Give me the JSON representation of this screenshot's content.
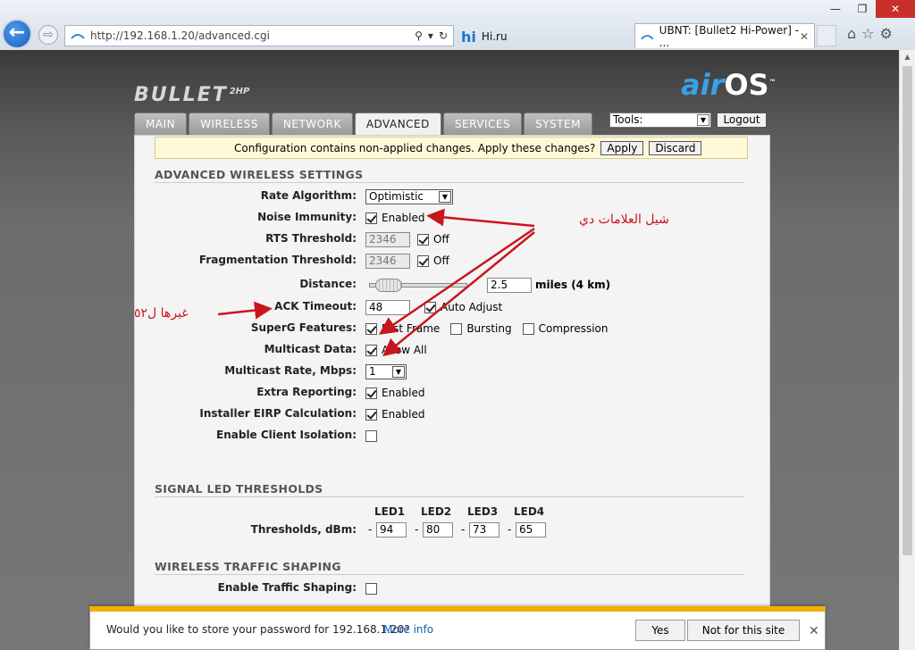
{
  "browser": {
    "address_url": "http://192.168.1.20/advanced.cgi",
    "tabs": [
      {
        "label": "Hi.ru"
      },
      {
        "label": "UBNT: [Bullet2 Hi-Power] - ..."
      }
    ],
    "window_controls": {
      "minimize": "—",
      "restore": "❐",
      "close": "✕"
    }
  },
  "header": {
    "product_logo": "BULLET",
    "product_logo_suffix": "2HP",
    "brand_air": "air",
    "brand_os": "OS",
    "brand_tm": "™"
  },
  "nav_tabs": [
    {
      "label": "MAIN"
    },
    {
      "label": "WIRELESS"
    },
    {
      "label": "NETWORK"
    },
    {
      "label": "ADVANCED"
    },
    {
      "label": "SERVICES"
    },
    {
      "label": "SYSTEM"
    }
  ],
  "tools": {
    "selected": "Tools:",
    "logout_label": "Logout"
  },
  "notice": {
    "text": "Configuration contains non-applied changes. Apply these changes?",
    "apply_label": "Apply",
    "discard_label": "Discard"
  },
  "advanced_wireless": {
    "title": "ADVANCED WIRELESS SETTINGS",
    "rate_algorithm": {
      "label": "Rate Algorithm:",
      "value": "Optimistic"
    },
    "noise_immunity": {
      "label": "Noise Immunity:",
      "checked": true,
      "text": "Enabled"
    },
    "rts_threshold": {
      "label": "RTS Threshold:",
      "value": "2346",
      "off_checked": true,
      "off_text": "Off"
    },
    "fragmentation_threshold": {
      "label": "Fragmentation Threshold:",
      "value": "2346",
      "off_checked": true,
      "off_text": "Off"
    },
    "distance": {
      "label": "Distance:",
      "value": "2.5",
      "unit": "miles (4 km)"
    },
    "ack_timeout": {
      "label": "ACK Timeout:",
      "value": "48",
      "auto_checked": true,
      "auto_text": "Auto Adjust"
    },
    "superg": {
      "label": "SuperG Features:",
      "fast_frame": {
        "checked": true,
        "text": "Fast Frame"
      },
      "bursting": {
        "checked": false,
        "text": "Bursting"
      },
      "compression": {
        "checked": false,
        "text": "Compression"
      }
    },
    "multicast_data": {
      "label": "Multicast Data:",
      "checked": true,
      "text": "Allow All"
    },
    "multicast_rate": {
      "label": "Multicast Rate, Mbps:",
      "value": "1"
    },
    "extra_reporting": {
      "label": "Extra Reporting:",
      "checked": true,
      "text": "Enabled"
    },
    "installer_eirp": {
      "label": "Installer EIRP Calculation:",
      "checked": true,
      "text": "Enabled"
    },
    "client_isolation": {
      "label": "Enable Client Isolation:",
      "checked": false
    }
  },
  "signal_led": {
    "title": "SIGNAL LED THRESHOLDS",
    "label": "Thresholds, dBm:",
    "leds": [
      {
        "name": "LED1",
        "value": "94"
      },
      {
        "name": "LED2",
        "value": "80"
      },
      {
        "name": "LED3",
        "value": "73"
      },
      {
        "name": "LED4",
        "value": "65"
      }
    ],
    "dash": "-"
  },
  "traffic_shaping": {
    "title": "WIRELESS TRAFFIC SHAPING",
    "enable_label": "Enable Traffic Shaping:",
    "enabled": false
  },
  "annotations": {
    "remove_marks": "شيل العلامات دي",
    "change_to_52": "غيرها ل٥٢"
  },
  "colors": {
    "annotation": "#c8161d",
    "accent_bar": "#f2b100",
    "brand_blue": "#3aa0e8"
  },
  "password_bar": {
    "message": "Would you like to store your password for 192.168.1.20?",
    "more_info": "More info",
    "yes_label": "Yes",
    "not_for_site_label": "Not for this site",
    "close": "✕"
  }
}
